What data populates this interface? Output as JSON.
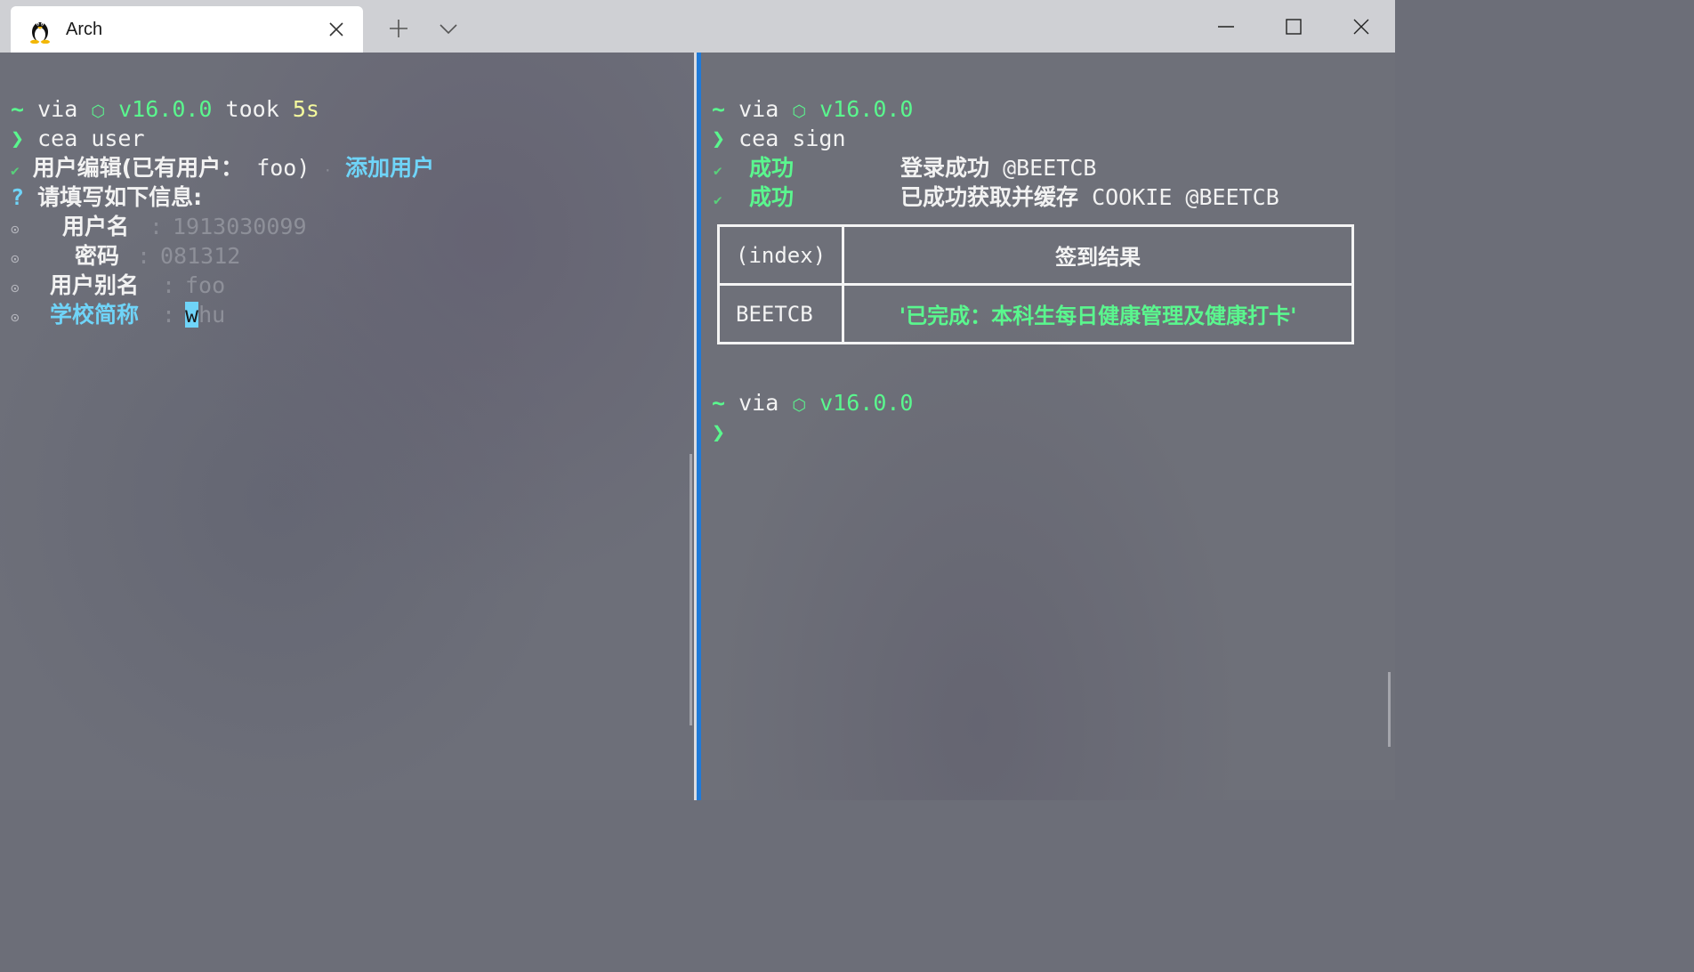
{
  "window": {
    "tab_title": "Arch",
    "tab_icon": "tux-penguin-icon",
    "new_tab_icon": "plus-icon",
    "dropdown_icon": "chevron-down-icon",
    "minimize_icon": "minimize-icon",
    "maximize_icon": "maximize-icon",
    "close_icon": "close-icon"
  },
  "left_pane": {
    "prompt": {
      "tilde": "~",
      "via": "via",
      "node_icon": "⬡",
      "node_version": "v16.0.0",
      "took": "took",
      "duration": "5s"
    },
    "command_arrow": "❯",
    "command": "cea user",
    "check_mark": "✔",
    "edit_line": "用户编辑(已有用户：",
    "edit_user": " foo)",
    "dot_sep": "·",
    "add_user": "添加用户",
    "question_mark": "?",
    "fill_info": "请填写如下信息:",
    "fields": [
      {
        "label": "用户名",
        "colon": ":",
        "value": "1913030099"
      },
      {
        "label": "密码",
        "colon": ":",
        "value": "081312"
      },
      {
        "label": "用户别名",
        "colon": ":",
        "value": "foo"
      },
      {
        "label": "学校简称",
        "colon": ":",
        "cursor_char": "w",
        "value": "hu"
      }
    ],
    "field_marker": "⊙"
  },
  "right_pane": {
    "prompt": {
      "tilde": "~",
      "via": "via",
      "node_icon": "⬡",
      "node_version": "v16.0.0"
    },
    "command_arrow": "❯",
    "command": "cea sign",
    "results": [
      {
        "check": "✔",
        "status": "成功",
        "message_cjk": "登录成功",
        "message_tail": " @BEETCB"
      },
      {
        "check": "✔",
        "status": "成功",
        "message_cjk": "已成功获取并缓存",
        "message_tail": " COOKIE @BEETCB"
      }
    ],
    "table": {
      "headers": [
        "(index)",
        "签到结果"
      ],
      "rows": [
        {
          "index": "BEETCB",
          "value": "'已完成：本科生每日健康管理及健康打卡'"
        }
      ]
    },
    "prompt2": {
      "tilde": "~",
      "via": "via",
      "node_icon": "⬡",
      "node_version": "v16.0.0"
    },
    "prompt2_arrow": "❯"
  },
  "colors": {
    "prompt_green": "#5af78e",
    "duration_yellow": "#f4f99d",
    "accent_cyan": "#6fd4f8",
    "active_pane_border": "#1f7ad8"
  }
}
